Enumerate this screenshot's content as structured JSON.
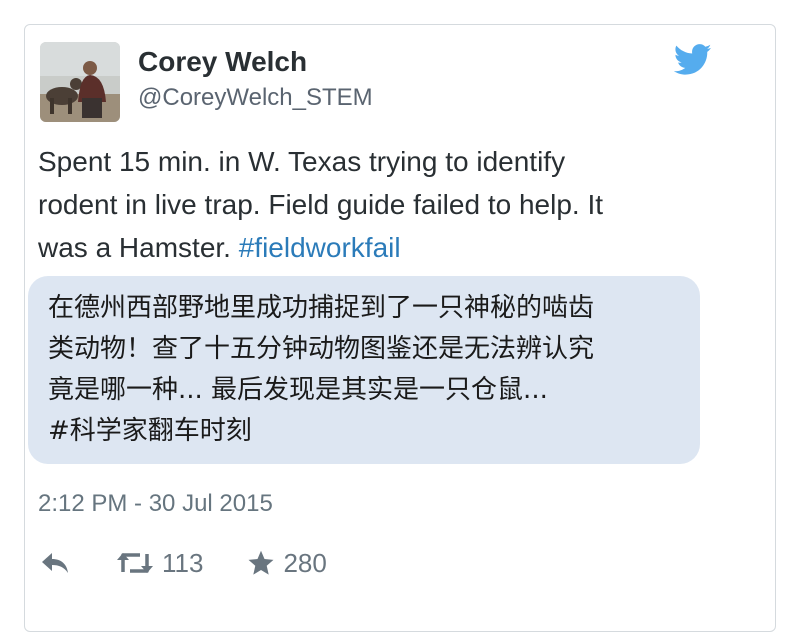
{
  "user": {
    "display_name": "Corey Welch",
    "handle": "@CoreyWelch_STEM",
    "avatar_icon": "profile-photo-person-with-dog"
  },
  "logo_icon": "twitter-bird-icon",
  "tweet": {
    "text_lines": [
      "Spent 15 min. in W. Texas trying to identify",
      "rodent in live trap.  Field guide failed to help. It",
      "was a Hamster. "
    ],
    "hashtag": "#fieldworkfail"
  },
  "translation": {
    "lines": [
      "在德州西部野地里成功捕捉到了一只神秘的啮齿",
      "类动物！查了十五分钟动物图鉴还是无法辨认究",
      "竟是哪一种... 最后发现是其实是一只仓鼠...",
      "#科学家翻车时刻"
    ]
  },
  "timestamp": "2:12 PM - 30 Jul 2015",
  "actions": {
    "reply_icon": "reply-icon",
    "retweet_icon": "retweet-icon",
    "retweet_count": "113",
    "favorite_icon": "star-icon",
    "favorite_count": "280"
  },
  "colors": {
    "hashtag": "#2b7bb9",
    "twitter_blue": "#55acee",
    "translation_bg": "#dde6f2"
  }
}
